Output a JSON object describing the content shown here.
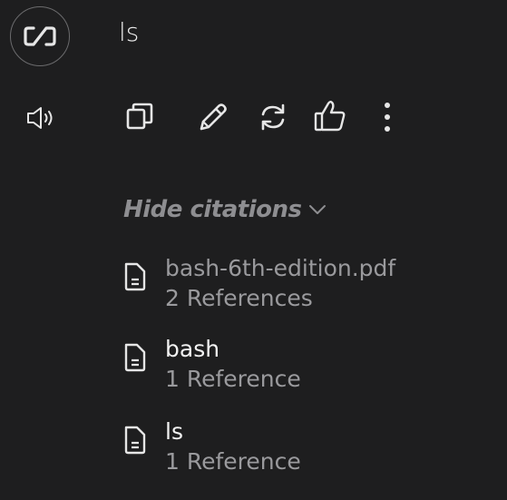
{
  "message": {
    "text": "ls",
    "avatar_icon": "logo-icon"
  },
  "actions": {
    "speaker_icon": "speaker-icon",
    "copy_icon": "copy-icon",
    "edit_icon": "pencil-icon",
    "regenerate_icon": "refresh-icon",
    "like_icon": "thumbs-up-icon",
    "more_icon": "more-vertical-icon"
  },
  "citations": {
    "toggle_label": "Hide citations",
    "items": [
      {
        "title": "bash-6th-edition.pdf",
        "references": "2 References"
      },
      {
        "title": "bash",
        "references": "1 Reference"
      },
      {
        "title": "ls",
        "references": "1 Reference"
      }
    ]
  },
  "colors": {
    "background": "#1e1e1f",
    "text_primary": "#f2f2f2",
    "text_muted": "#9a9a9d"
  }
}
